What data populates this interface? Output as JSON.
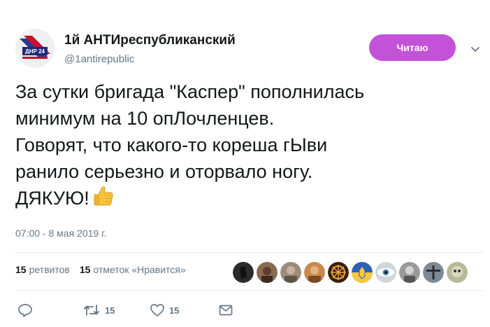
{
  "author": {
    "name": "1й АНТИреспубликанский",
    "handle": "@1antirepublic",
    "avatar_label": "ДНР 24"
  },
  "follow_button": {
    "label": "Читаю",
    "color": "#c352d9"
  },
  "menu": {
    "icon": "chevron-down-icon"
  },
  "tweet": {
    "lines": [
      "За сутки бригада \"Каспер\" пополнилась",
      "минимум на 10 опЛочленцев.",
      "Говорят, что какого-то кореша гЫви",
      "ранило серьезно и оторвало ногу.",
      "ДЯКУЮ!"
    ],
    "emoji": "thumbs-up",
    "timestamp": "07:00 - 8 мая 2019 г."
  },
  "stats": {
    "retweets_count": "15",
    "retweets_label": "ретвитов",
    "likes_count": "15",
    "likes_label": "отметок «Нравится»"
  },
  "likers": [
    {
      "name": "liker-avatar-1",
      "color": "#2b2b2b"
    },
    {
      "name": "liker-avatar-2",
      "color": "#8a6a50"
    },
    {
      "name": "liker-avatar-3",
      "color": "#9b8b7a"
    },
    {
      "name": "liker-avatar-4",
      "color": "#c8894d"
    },
    {
      "name": "liker-avatar-5",
      "color": "#3a1e0f"
    },
    {
      "name": "liker-avatar-6",
      "color": "#2f5fb8"
    },
    {
      "name": "liker-avatar-7",
      "color": "#cfd6dc"
    },
    {
      "name": "liker-avatar-8",
      "color": "#9a9a9a"
    },
    {
      "name": "liker-avatar-9",
      "color": "#7d8a95"
    },
    {
      "name": "liker-avatar-10",
      "color": "#b7b99a"
    }
  ],
  "actions": {
    "reply_icon": "reply-icon",
    "retweet_icon": "retweet-icon",
    "retweet_count": "15",
    "like_icon": "heart-icon",
    "like_count": "15",
    "dm_icon": "envelope-icon"
  },
  "colors": {
    "text": "#14171a",
    "secondary": "#657786",
    "divider": "#e6ecf0"
  }
}
